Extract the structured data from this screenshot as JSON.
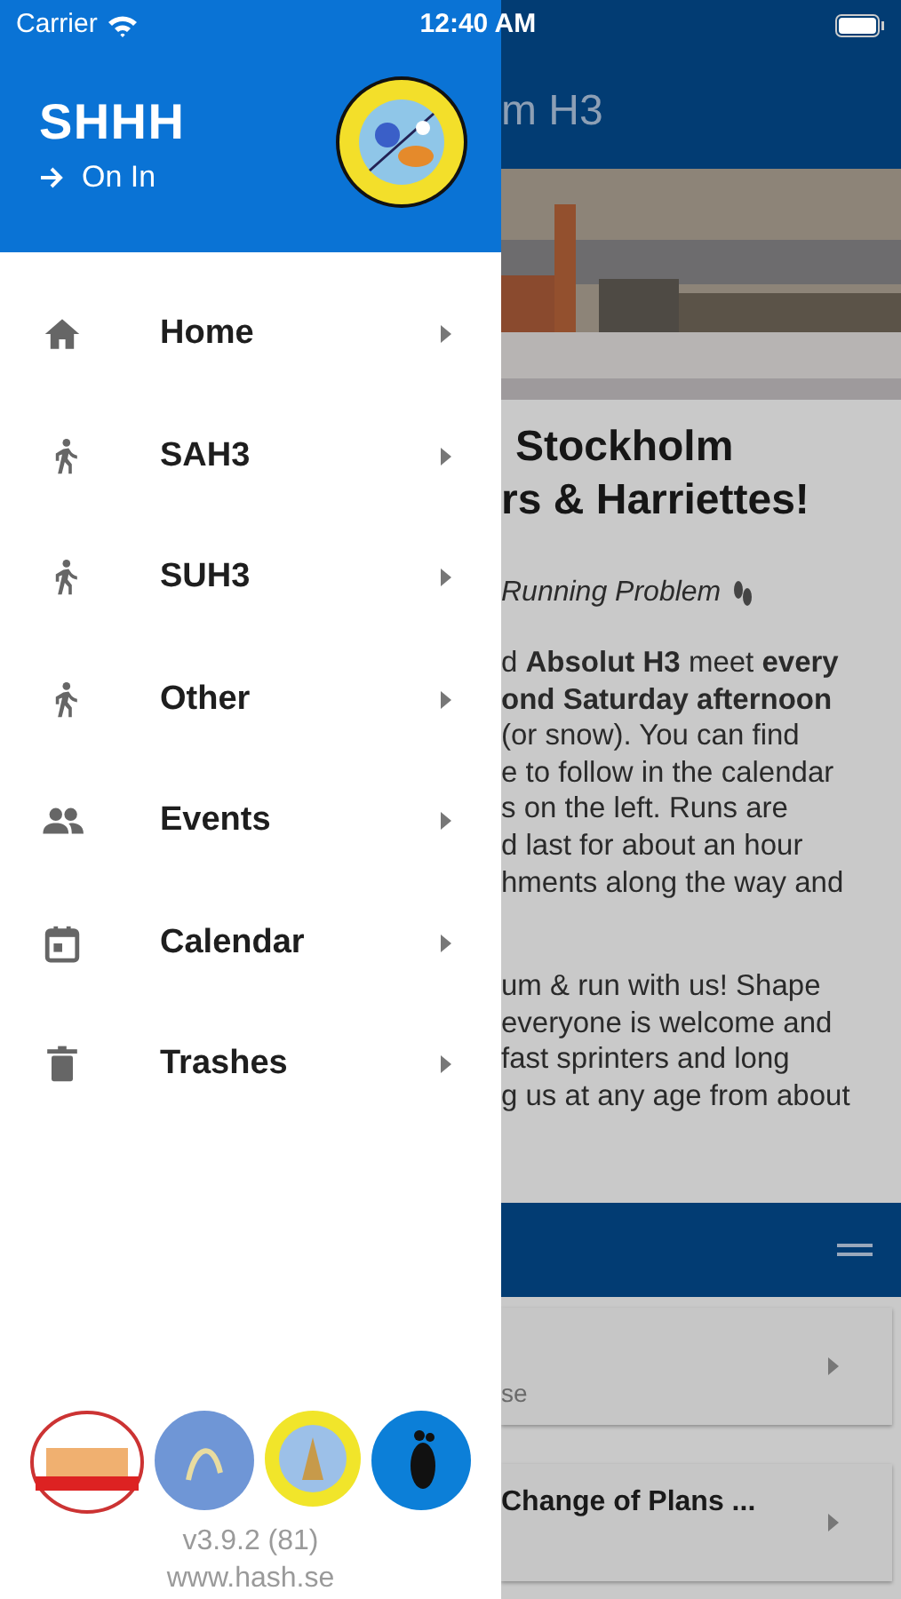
{
  "status_bar": {
    "carrier": "Carrier",
    "time": "12:40 AM"
  },
  "drawer": {
    "title": "SHHH",
    "subtitle": "On In",
    "items": [
      {
        "label": "Home",
        "kind": "home"
      },
      {
        "label": "SAH3",
        "kind": "runner"
      },
      {
        "label": "SUH3",
        "kind": "runner"
      },
      {
        "label": "Other",
        "kind": "runner"
      },
      {
        "label": "Events",
        "kind": "people"
      },
      {
        "label": "Calendar",
        "kind": "calendar"
      },
      {
        "label": "Trashes",
        "kind": "trash"
      }
    ],
    "version": "v3.9.2 (81)",
    "website": "www.hash.se"
  },
  "background": {
    "title": "m H3",
    "heading": [
      "Stockholm",
      "rs & Harriettes!"
    ],
    "tagline": "Running Problem",
    "paragraphs": [
      [
        "d **Absolut H3** meet **every**",
        "**ond Saturday afternoon**",
        "(or snow). You can find",
        "e to follow in the calendar",
        "s on the left. Runs are",
        "d last for about an hour",
        "hments along the way and"
      ],
      [
        "um & run with us! Shape",
        "everyone is welcome and",
        "fast sprinters and long",
        "g us at any age from about"
      ]
    ],
    "cards": [
      {
        "subtitle": "se"
      },
      {
        "title": "Change of Plans ..."
      }
    ]
  }
}
